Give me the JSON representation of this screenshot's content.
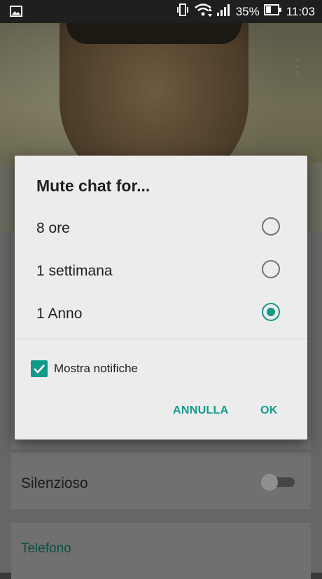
{
  "status_bar": {
    "battery": "35%",
    "time": "11:03"
  },
  "dialog": {
    "title": "Mute chat for...",
    "options": [
      {
        "label": "8 ore",
        "selected": false
      },
      {
        "label": "1 settimana",
        "selected": false
      },
      {
        "label": "1 Anno",
        "selected": true
      }
    ],
    "show_notifications": {
      "label": "Mostra notifiche",
      "checked": true
    },
    "cancel_label": "ANNULLA",
    "ok_label": "OK"
  },
  "background": {
    "silent_label": "Silenzioso",
    "phone_section_label": "Telefono"
  },
  "colors": {
    "accent": "#11998a",
    "dialog_bg": "#ececec"
  }
}
